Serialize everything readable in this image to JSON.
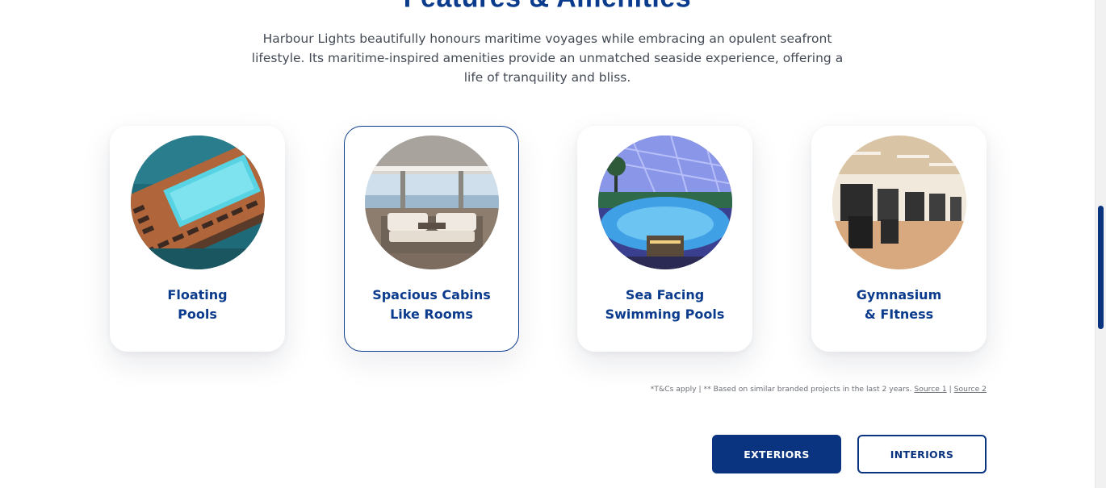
{
  "section": {
    "heading": "Features & Amenities",
    "intro": "Harbour Lights beautifully honours maritime voyages while embracing an opulent seafront lifestyle. Its maritime-inspired amenities provide an unmatched seaside experience, offering a life of tranquility and bliss."
  },
  "cards": [
    {
      "line1": "Floating",
      "line2": "Pools",
      "image": "floating-pool-photo"
    },
    {
      "line1": "Spacious Cabins",
      "line2": "Like Rooms",
      "image": "cabin-lounge-photo",
      "active": true
    },
    {
      "line1": "Sea Facing",
      "line2": "Swimming Pools",
      "image": "indoor-pool-photo"
    },
    {
      "line1": "Gymnasium",
      "line2": "& FItness",
      "image": "gym-photo"
    }
  ],
  "disclaimer": {
    "text": "*T&Cs apply | ** Based on similar branded projects in the last 2 years.",
    "source1": "Source 1",
    "separator": "|",
    "source2": "Source 2"
  },
  "buttons": {
    "exteriors": "EXTERIORS",
    "interiors": "INTERIORS"
  },
  "colors": {
    "brand": "#0b3480",
    "heading": "#0b3b8c",
    "body_text": "#444b55"
  }
}
